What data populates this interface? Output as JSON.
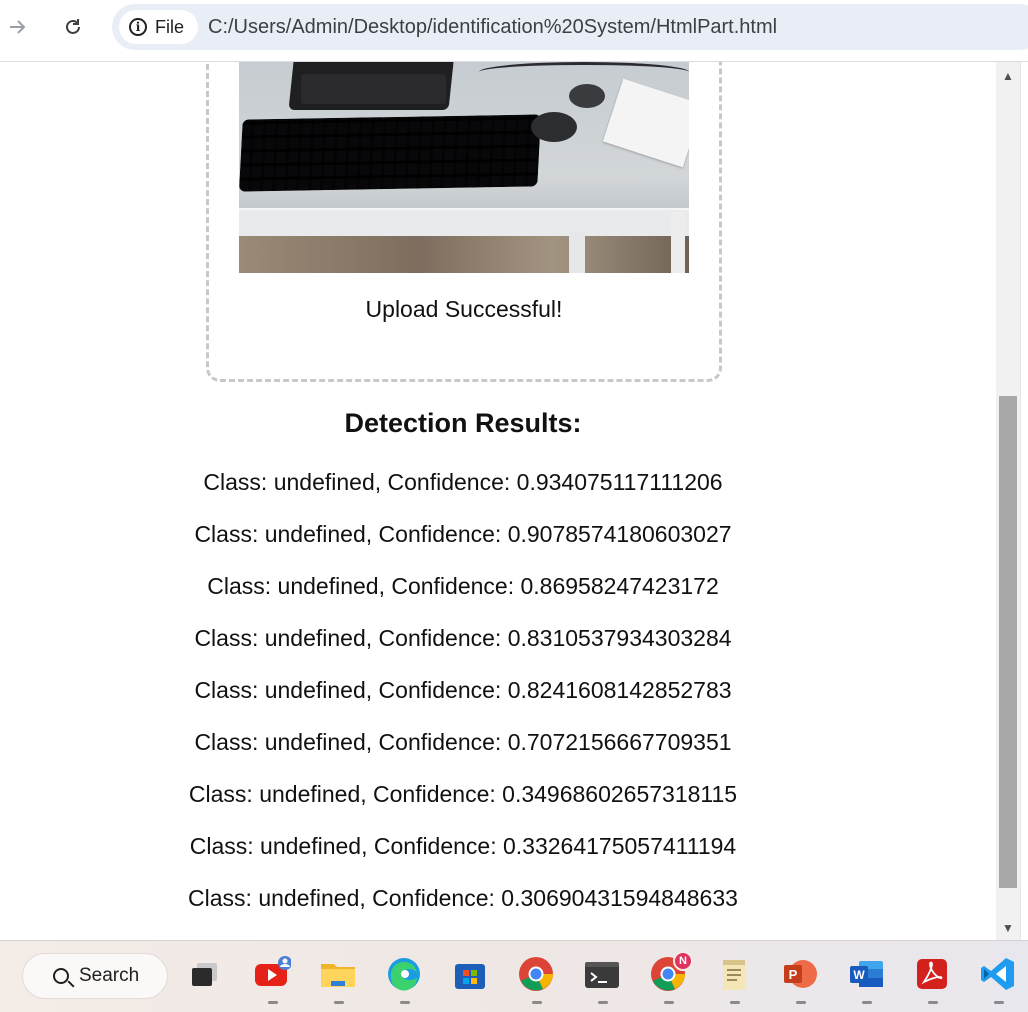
{
  "browser": {
    "site_chip_label": "File",
    "url": "C:/Users/Admin/Desktop/identification%20System/HtmlPart.html"
  },
  "upload": {
    "status": "Upload Successful!"
  },
  "results": {
    "title": "Detection Results:",
    "items": [
      "Class: undefined, Confidence: 0.934075117111206",
      "Class: undefined, Confidence: 0.9078574180603027",
      "Class: undefined, Confidence: 0.86958247423172",
      "Class: undefined, Confidence: 0.8310537934303284",
      "Class: undefined, Confidence: 0.8241608142852783",
      "Class: undefined, Confidence: 0.7072156667709351",
      "Class: undefined, Confidence: 0.34968602657318115",
      "Class: undefined, Confidence: 0.33264175057411194",
      "Class: undefined, Confidence: 0.30690431594848633"
    ]
  },
  "taskbar": {
    "search_label": "Search",
    "chrome_badge": "N",
    "apps": [
      "task-view-icon",
      "youtube-icon",
      "file-explorer-icon",
      "edge-icon",
      "microsoft-store-icon",
      "chrome-icon",
      "terminal-icon",
      "chrome-profile-icon",
      "notepad-icon",
      "powerpoint-icon",
      "word-icon",
      "acrobat-icon",
      "vscode-icon"
    ]
  },
  "colors": {
    "omnibox_bg": "#e9eef6",
    "scroll_thumb": "#a8a8a8",
    "upload_border": "#c8c8c8"
  }
}
